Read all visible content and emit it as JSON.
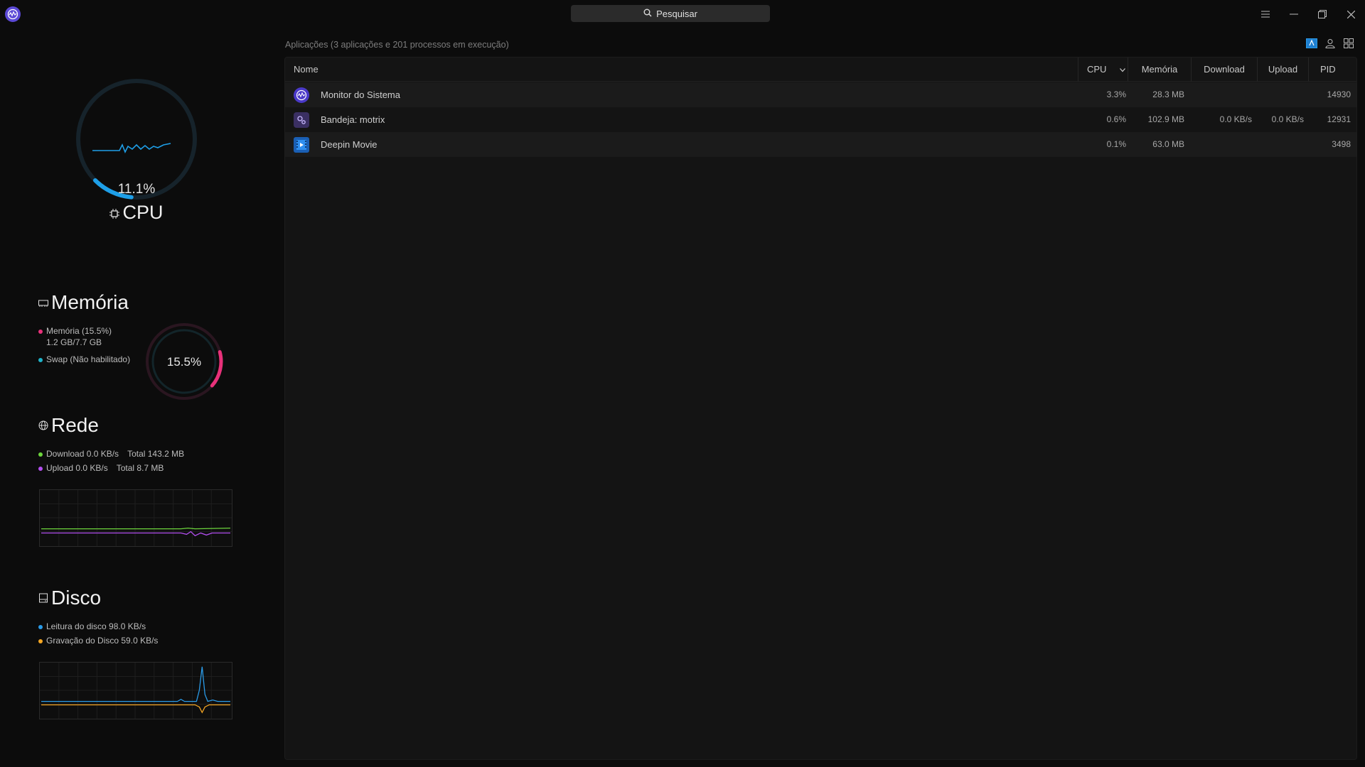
{
  "search": {
    "label": "Pesquisar"
  },
  "cpu": {
    "percent": "11.1%",
    "title": "CPU",
    "fraction": 0.111
  },
  "memory": {
    "title": "Memória",
    "percent": "15.5%",
    "fraction": 0.155,
    "legend_mem": "Memória (15.5%)",
    "legend_mem_detail": "1.2 GB/7.7 GB",
    "legend_swap": "Swap (Não habilitado)",
    "colors": {
      "mem": "#e8317a",
      "swap": "#1fb3c9"
    }
  },
  "network": {
    "title": "Rede",
    "download": "Download 0.0 KB/s",
    "download_total": "Total 143.2 MB",
    "upload": "Upload 0.0 KB/s",
    "upload_total": "Total 8.7 MB",
    "colors": {
      "download": "#6cd43c",
      "upload": "#b34ef0"
    }
  },
  "disk": {
    "title": "Disco",
    "read": "Leitura do disco 98.0 KB/s",
    "write": "Gravação do Disco 59.0 KB/s",
    "colors": {
      "read": "#2a9be8",
      "write": "#f5a623"
    }
  },
  "summary": "Aplicações (3 aplicações e 201 processos em execução)",
  "table": {
    "headers": {
      "name": "Nome",
      "cpu": "CPU",
      "memory": "Memória",
      "download": "Download",
      "upload": "Upload",
      "pid": "PID"
    },
    "rows": [
      {
        "name": "Monitor do Sistema",
        "icon": "system-monitor-icon",
        "cpu": "3.3%",
        "memory": "28.3 MB",
        "download": "",
        "upload": "",
        "pid": "14930"
      },
      {
        "name": "Bandeja: motrix",
        "icon": "motrix-icon",
        "cpu": "0.6%",
        "memory": "102.9 MB",
        "download": "0.0 KB/s",
        "upload": "0.0 KB/s",
        "pid": "12931"
      },
      {
        "name": "Deepin Movie",
        "icon": "deepin-movie-icon",
        "cpu": "0.1%",
        "memory": "63.0 MB",
        "download": "",
        "upload": "",
        "pid": "3498"
      }
    ]
  },
  "accent": "#2a9be8"
}
